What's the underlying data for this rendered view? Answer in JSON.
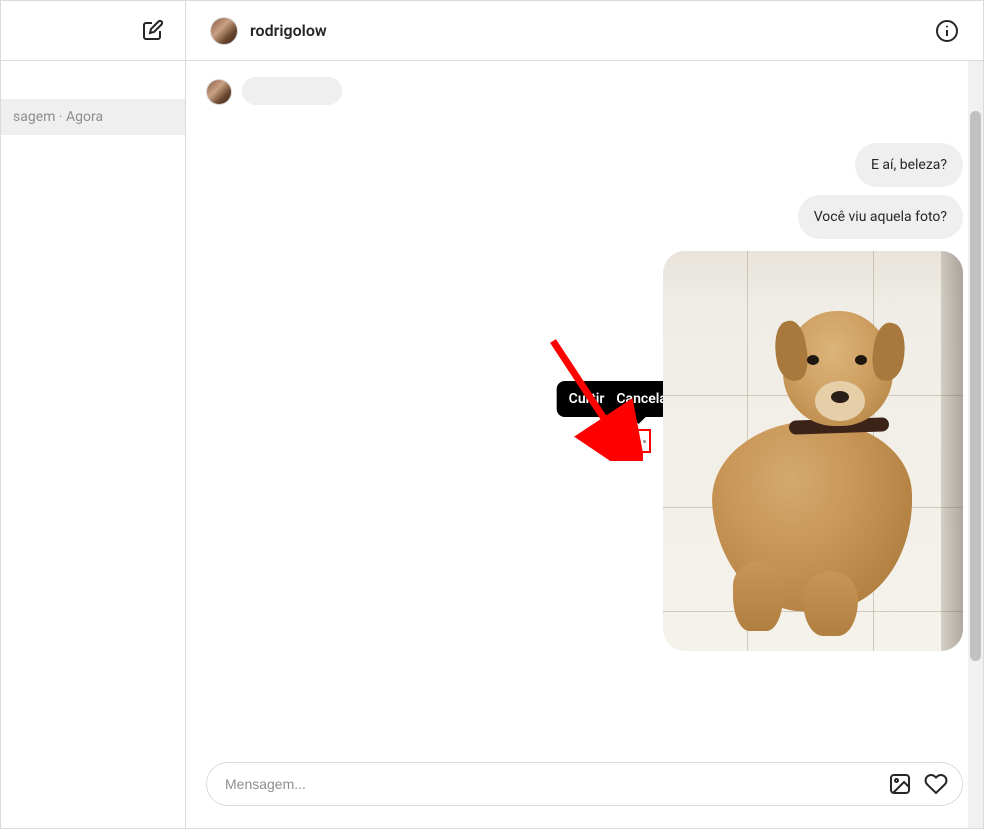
{
  "sidebar": {
    "preview_text": "sagem · Agora"
  },
  "chat": {
    "username": "rodrigolow",
    "messages": [
      {
        "text": "E aí, beleza?"
      },
      {
        "text": "Você viu aquela foto?"
      }
    ],
    "tooltip": {
      "like": "Curtir",
      "unsend": "Cancelar envio"
    }
  },
  "composer": {
    "placeholder": "Mensagem..."
  },
  "icons": {
    "compose": "compose-icon",
    "info": "info-icon",
    "image": "image-icon",
    "heart": "heart-icon",
    "more": "more-icon"
  },
  "annotation": {
    "color": "#ff0000"
  }
}
